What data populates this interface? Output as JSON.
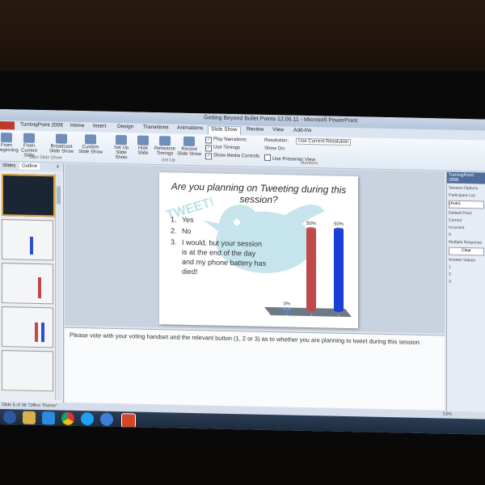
{
  "window": {
    "title": "Getting Beyond Bullet Points 12.06.11 - Microsoft PowerPoint"
  },
  "ribbon": {
    "tabs": [
      "File",
      "TurningPoint 2008",
      "Home",
      "Insert",
      "Design",
      "Transitions",
      "Animations",
      "Slide Show",
      "Review",
      "View",
      "Add-Ins"
    ],
    "active_tab": "Slide Show",
    "buttons": [
      {
        "label": "From Beginning",
        "icon": "slideshow-icon"
      },
      {
        "label": "From Current Slide",
        "icon": "slideshow-icon"
      },
      {
        "label": "Broadcast Slide Show",
        "icon": "broadcast-icon"
      },
      {
        "label": "Custom Slide Show",
        "icon": "custom-show-icon"
      },
      {
        "label": "Set Up Slide Show",
        "icon": "setup-icon"
      },
      {
        "label": "Hide Slide",
        "icon": "hide-icon"
      },
      {
        "label": "Rehearse Timings",
        "icon": "clock-icon"
      },
      {
        "label": "Record Slide Show",
        "icon": "record-icon"
      }
    ],
    "checkboxes": [
      {
        "label": "Play Narrations",
        "checked": true
      },
      {
        "label": "Use Timings",
        "checked": true
      },
      {
        "label": "Show Media Controls",
        "checked": true
      }
    ],
    "monitor": {
      "resolution_label": "Resolution:",
      "resolution_value": "Use Current Resolution",
      "show_on_label": "Show On:",
      "presenter_view_label": "Use Presenter View"
    },
    "groups": [
      "Start Slide Show",
      "Set Up",
      "Monitors"
    ]
  },
  "left_pane": {
    "tabs": [
      "Slides",
      "Outline"
    ],
    "active_tab": "Outline",
    "close": "x"
  },
  "slide": {
    "title": "Are you planning on Tweeting during this session?",
    "watermark": "TWEET!",
    "options": [
      {
        "num": "1.",
        "text": "Yes"
      },
      {
        "num": "2.",
        "text": "No"
      },
      {
        "num": "3.",
        "text": "I would, but your session is at the end of the day and my phone battery has died!"
      }
    ]
  },
  "chart_data": {
    "type": "bar",
    "categories": [
      "1",
      "2",
      "3"
    ],
    "values": [
      0,
      50,
      50
    ],
    "value_labels": [
      "0%",
      "50%",
      "50%"
    ],
    "ylim": [
      0,
      50
    ],
    "colors": [
      "#5b8fc7",
      "#c04a4a",
      "#1a3fd6"
    ]
  },
  "notes": {
    "text": "Please vote with your voting handset and the relevant button (1, 2 or 3) as to whether you are planning to tweet during this session."
  },
  "right_pane": {
    "title": "TurningPoint 2008",
    "items": [
      "Session Options",
      "Participant List",
      "(Auto)",
      "Default Point",
      "Correct",
      "Incorrect",
      "0",
      "Multiple Response",
      "Clear",
      "Answer Values",
      "1",
      "2",
      "3"
    ]
  },
  "status": {
    "slide_of": "Slide 6 of 38",
    "theme": "\"Office Theme\"",
    "zoom": "53%"
  },
  "taskbar": {
    "apps": [
      "windows-icon",
      "explorer-icon",
      "dropbox-icon",
      "chrome-icon",
      "skype-icon",
      "ie-icon",
      "powerpoint-icon"
    ]
  }
}
